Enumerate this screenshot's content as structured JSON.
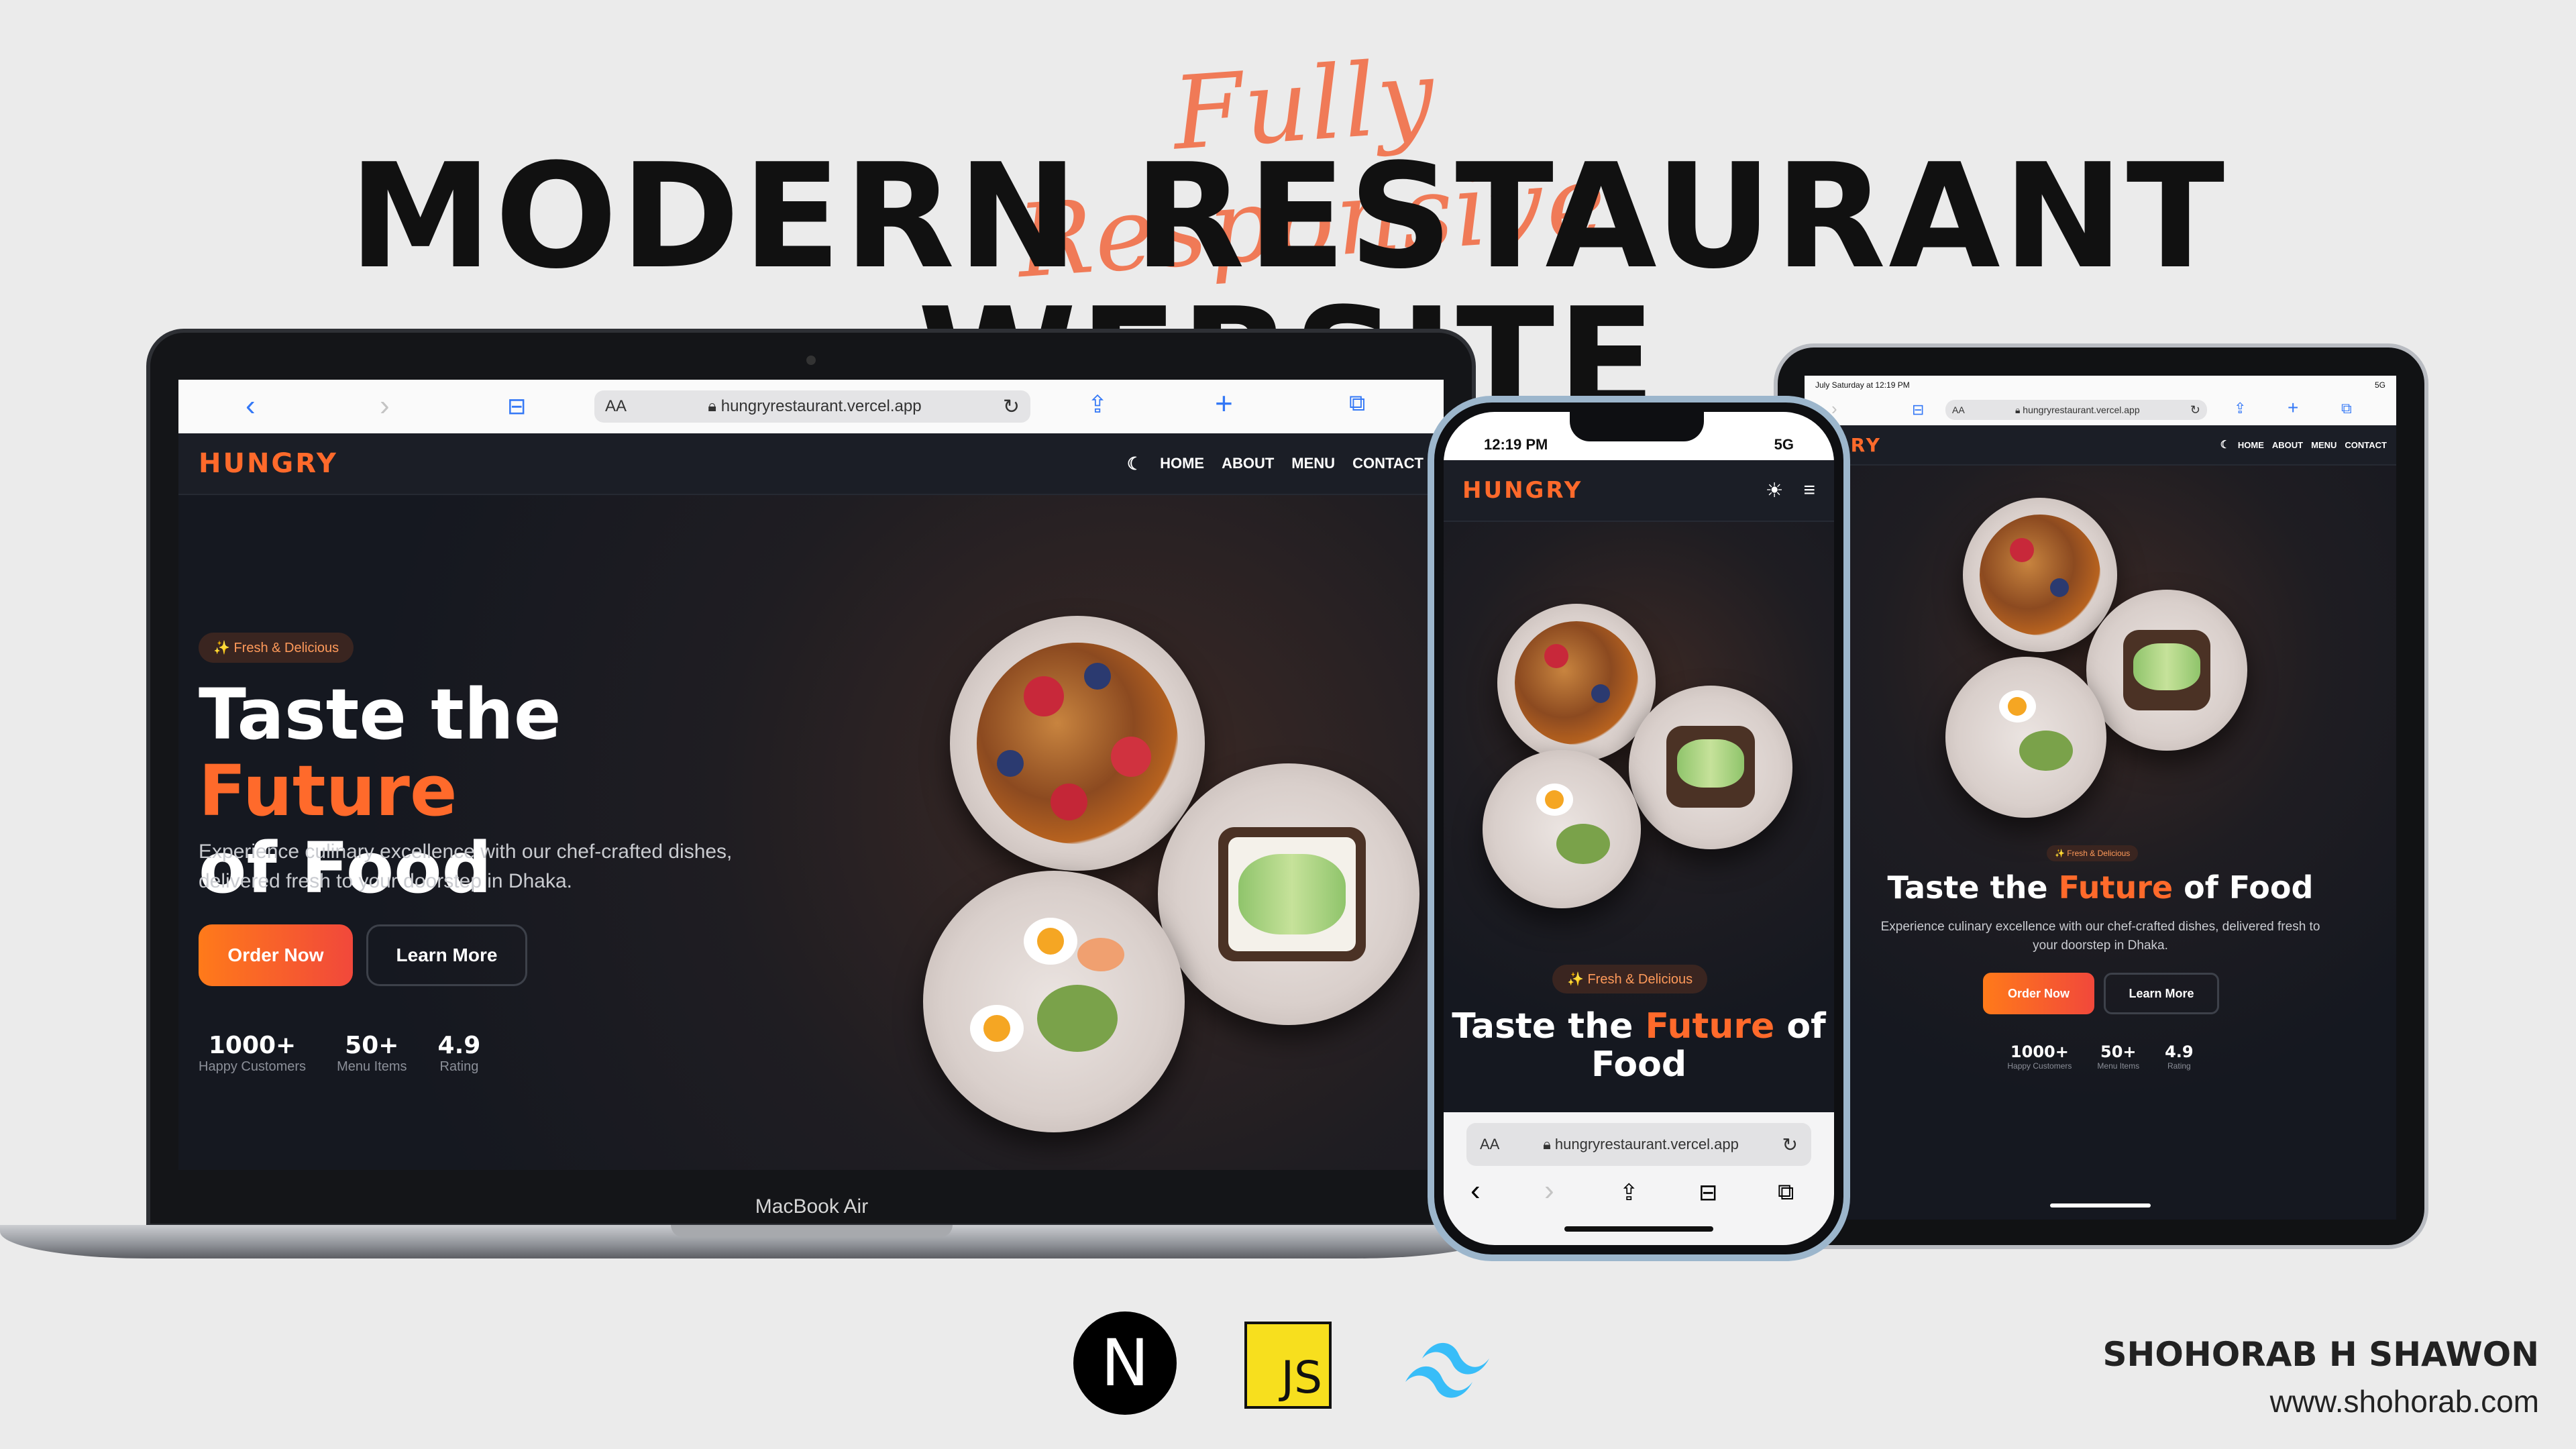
{
  "header": {
    "tagline": "Fully Responsive",
    "title": "MODERN RESTAURANT WEBSITE"
  },
  "site": {
    "url": "hungryrestaurant.vercel.app",
    "aa": "AA",
    "aa_phone": "AA",
    "logo": "HUNGRY",
    "nav": [
      "HOME",
      "ABOUT",
      "MENU",
      "CONTACT"
    ],
    "badge": "✨ Fresh & Delicious",
    "hero_title_part1": "Taste the ",
    "hero_title_accent": "Future",
    "hero_title_part2": " of Food",
    "lap_title_line2": "of Food",
    "description": "Experience culinary excellence with our chef-crafted dishes, delivered fresh to your doorstep in Dhaka.",
    "primary_button": "Order Now",
    "secondary_button": "Learn More",
    "stats": [
      {
        "value": "1000+",
        "label": "Happy Customers"
      },
      {
        "value": "50+",
        "label": "Menu Items"
      },
      {
        "value": "4.9",
        "label": "Rating"
      }
    ]
  },
  "devices": {
    "laptop_label": "MacBook Air",
    "phone_time": "12:19 PM",
    "phone_signal": "5G",
    "tablet_time": "July Saturday at 12:19 PM",
    "tablet_signal": "5G"
  },
  "phone": {
    "title_line2": "Food",
    "title_line1_part1": "Taste the ",
    "title_line1_accent": "Future",
    "title_line1_part2": " of"
  },
  "tech": {
    "next": "N",
    "js": "JS"
  },
  "author": {
    "name": "SHOHORAB H SHAWON",
    "website": "www.shohorab.com"
  },
  "colors": {
    "accent": "#ff6a2b",
    "tagline": "#f07a57",
    "browser_icon": "#3478f6",
    "site_bg": "#1a1d24"
  }
}
